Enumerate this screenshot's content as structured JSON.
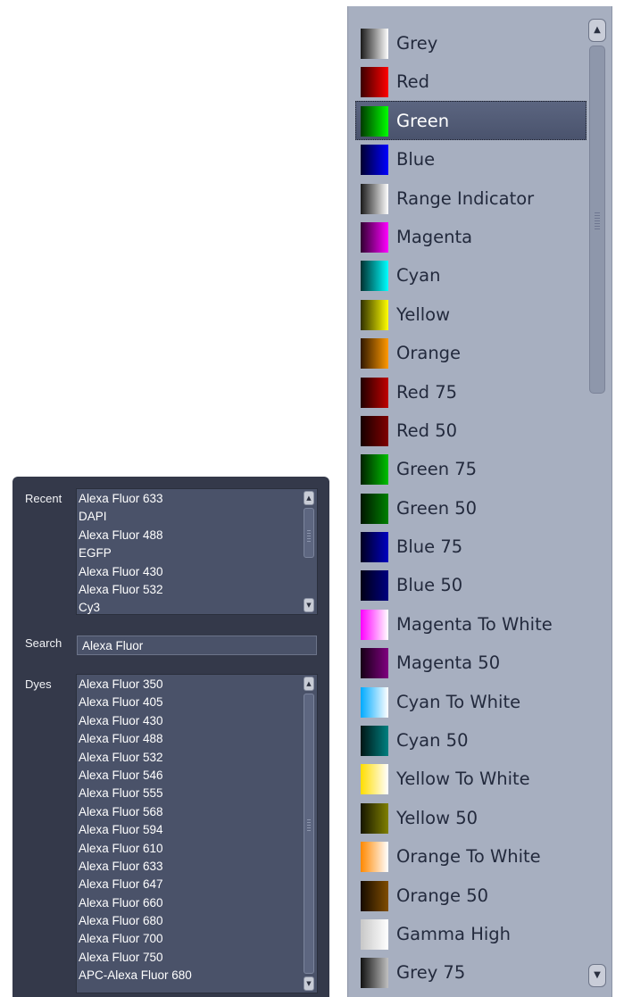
{
  "recent": {
    "label": "Recent",
    "items": [
      "Alexa Fluor 633",
      "DAPI",
      "Alexa Fluor 488",
      "EGFP",
      "Alexa Fluor 430",
      "Alexa Fluor 532",
      "Cy3"
    ]
  },
  "search": {
    "label": "Search",
    "value": "Alexa Fluor"
  },
  "dyes": {
    "label": "Dyes",
    "items": [
      "Alexa Fluor 350",
      "Alexa Fluor 405",
      "Alexa Fluor 430",
      "Alexa Fluor 488",
      "Alexa Fluor 532",
      "Alexa Fluor 546",
      "Alexa Fluor 555",
      "Alexa Fluor 568",
      "Alexa Fluor 594",
      "Alexa Fluor 610",
      "Alexa Fluor 633",
      "Alexa Fluor 647",
      "Alexa Fluor 660",
      "Alexa Fluor 680",
      "Alexa Fluor 700",
      "Alexa Fluor 750",
      "APC-Alexa Fluor 680"
    ]
  },
  "lut_dropdown": {
    "selected": "Green",
    "items": [
      {
        "name": "Grey",
        "colors": [
          "#1a1a1a",
          "#ffffff"
        ]
      },
      {
        "name": "Red",
        "colors": [
          "#3a0000",
          "#ff0000"
        ]
      },
      {
        "name": "Green",
        "colors": [
          "#003a00",
          "#00ff00"
        ]
      },
      {
        "name": "Blue",
        "colors": [
          "#00002e",
          "#0000ff"
        ]
      },
      {
        "name": "Range Indicator",
        "colors": [
          "#1a1a1a",
          "#ffffff"
        ]
      },
      {
        "name": "Magenta",
        "colors": [
          "#300030",
          "#ff00ff"
        ]
      },
      {
        "name": "Cyan",
        "colors": [
          "#003030",
          "#00ffff"
        ]
      },
      {
        "name": "Yellow",
        "colors": [
          "#303000",
          "#ffff00"
        ]
      },
      {
        "name": "Orange",
        "colors": [
          "#301800",
          "#ff9900"
        ]
      },
      {
        "name": "Red 75",
        "colors": [
          "#200000",
          "#c00000"
        ]
      },
      {
        "name": "Red 50",
        "colors": [
          "#150000",
          "#800000"
        ]
      },
      {
        "name": "Green 75",
        "colors": [
          "#002000",
          "#00c000"
        ]
      },
      {
        "name": "Green 50",
        "colors": [
          "#001500",
          "#008000"
        ]
      },
      {
        "name": "Blue 75",
        "colors": [
          "#000020",
          "#0000c0"
        ]
      },
      {
        "name": "Blue 50",
        "colors": [
          "#000015",
          "#000080"
        ]
      },
      {
        "name": "Magenta To White",
        "colors": [
          "#ff00ff",
          "#ffffff"
        ]
      },
      {
        "name": "Magenta 50",
        "colors": [
          "#150015",
          "#800080"
        ]
      },
      {
        "name": "Cyan To White",
        "colors": [
          "#00aaff",
          "#ffffff"
        ]
      },
      {
        "name": "Cyan 50",
        "colors": [
          "#001515",
          "#008080"
        ]
      },
      {
        "name": "Yellow To White",
        "colors": [
          "#ffdd00",
          "#ffffff"
        ]
      },
      {
        "name": "Yellow 50",
        "colors": [
          "#151500",
          "#808000"
        ]
      },
      {
        "name": "Orange To White",
        "colors": [
          "#ff8800",
          "#ffffff"
        ]
      },
      {
        "name": "Orange 50",
        "colors": [
          "#150a00",
          "#804d00"
        ]
      },
      {
        "name": "Gamma High",
        "colors": [
          "#c8c8c8",
          "#ffffff"
        ]
      },
      {
        "name": "Grey 75",
        "colors": [
          "#111111",
          "#c0c0c0"
        ]
      }
    ]
  }
}
